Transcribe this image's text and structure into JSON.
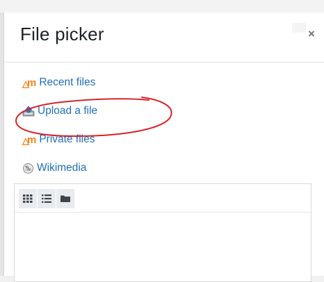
{
  "dialog": {
    "title": "File picker",
    "close_label": "×"
  },
  "repositories": [
    {
      "label": "Recent files",
      "icon": "moodle-logo-icon"
    },
    {
      "label": "Upload a file",
      "icon": "upload-icon"
    },
    {
      "label": "Private files",
      "icon": "moodle-logo-icon"
    },
    {
      "label": "Wikimedia",
      "icon": "wikimedia-icon"
    }
  ],
  "toolbar": {
    "views": [
      "grid-view-icon",
      "list-view-icon",
      "folder-view-icon"
    ]
  },
  "annotation": {
    "color": "#d8232a"
  },
  "colors": {
    "link": "#1f6fb5",
    "moodle_orange": "#f98012"
  }
}
